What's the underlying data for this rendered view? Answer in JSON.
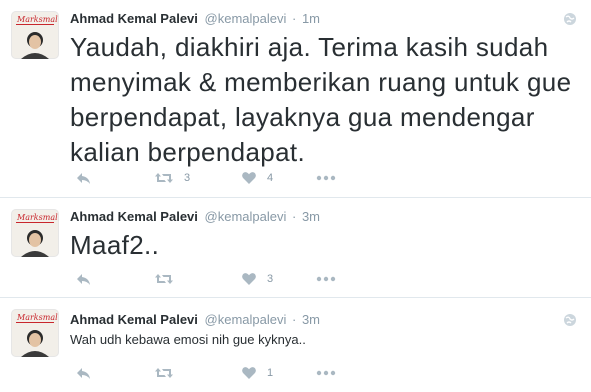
{
  "tweets": [
    {
      "fullname": "Ahmad Kemal Palevi",
      "username": "@kemalpalevi",
      "separator": "·",
      "time": "1m",
      "text": "Yaudah, diakhiri aja. Terima kasih sudah menyimak & memberikan ruang untuk gue berpendapat, layaknya gua mendengar kalian berpendapat.",
      "retweet_count": "3",
      "like_count": "4",
      "avatar_logo_text": "Marksmal"
    },
    {
      "fullname": "Ahmad Kemal Palevi",
      "username": "@kemalpalevi",
      "separator": "·",
      "time": "3m",
      "text": "Maaf2..",
      "retweet_count": "",
      "like_count": "3",
      "avatar_logo_text": "Marksmal"
    },
    {
      "fullname": "Ahmad Kemal Palevi",
      "username": "@kemalpalevi",
      "separator": "·",
      "time": "3m",
      "text": "Wah udh kebawa emosi nih gue kyknya..",
      "retweet_count": "",
      "like_count": "1",
      "avatar_logo_text": "Marksmal"
    }
  ],
  "icons": {
    "reply": "reply-icon",
    "retweet": "retweet-icon",
    "like": "heart-icon",
    "more": "more-icon",
    "globe": "globe-icon"
  },
  "colors": {
    "text": "#292f33",
    "secondary": "#8899a6",
    "icon": "#aab8c2",
    "divider": "#e1e8ed",
    "logo_red": "#c8262c"
  }
}
